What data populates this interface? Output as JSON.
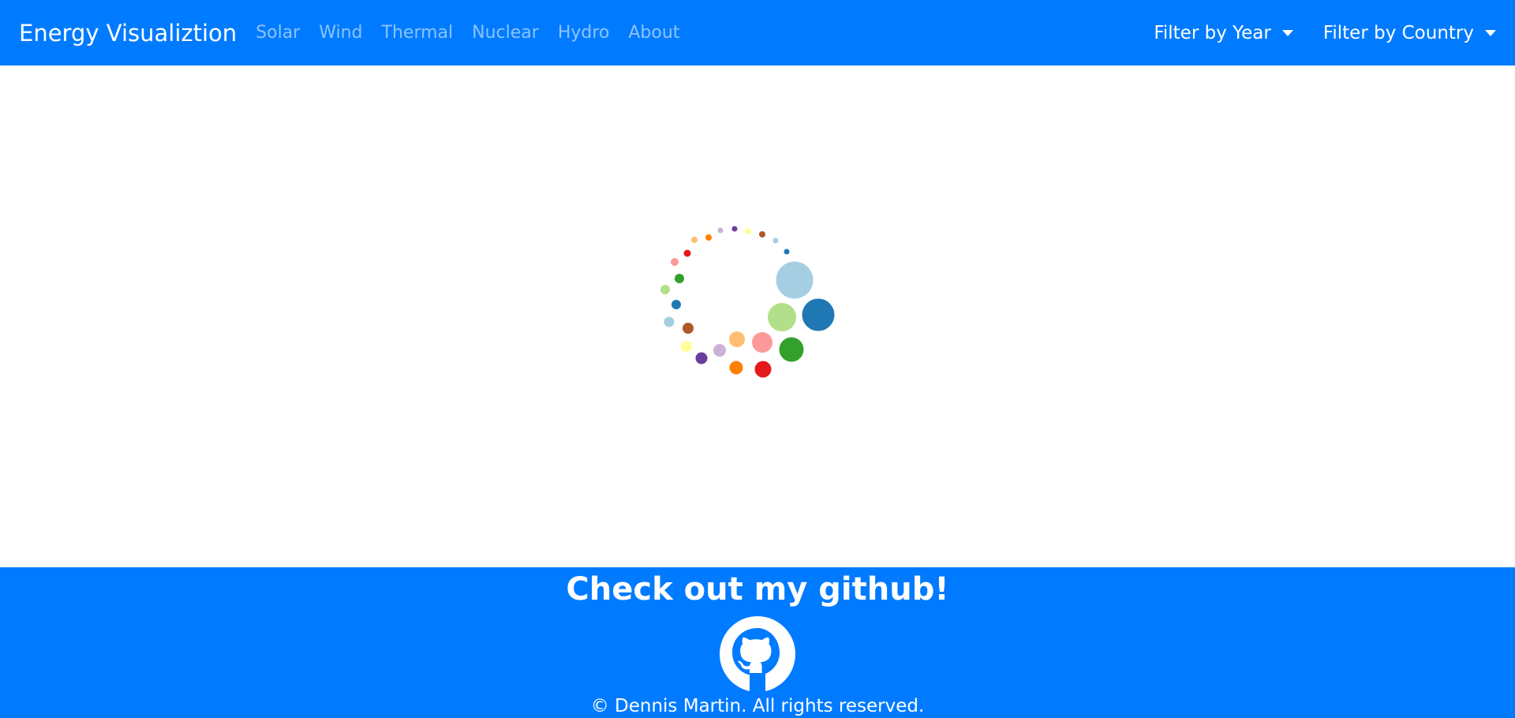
{
  "navbar": {
    "brand": "Energy Visualiztion",
    "links": [
      "Solar",
      "Wind",
      "Thermal",
      "Nuclear",
      "Hydro",
      "About"
    ],
    "filters": {
      "year_label": "Filter by Year",
      "country_label": "Filter by Country"
    }
  },
  "loading_spinner": {
    "icon": "dotted-loading-spinner-icon",
    "colors": [
      "#a6cee3",
      "#1f78b4",
      "#b2df8a",
      "#33a02c",
      "#fb9a99",
      "#e31a1c",
      "#fdbf6f",
      "#ff7f00",
      "#cab2d6",
      "#6a3d9a",
      "#ffff99",
      "#b15928"
    ]
  },
  "footer": {
    "title": "Check out my github!",
    "icon": "github-icon",
    "copyright": "© Dennis Martin. All rights reserved."
  },
  "colors": {
    "primary": "#007bff",
    "background": "#ffffff"
  }
}
